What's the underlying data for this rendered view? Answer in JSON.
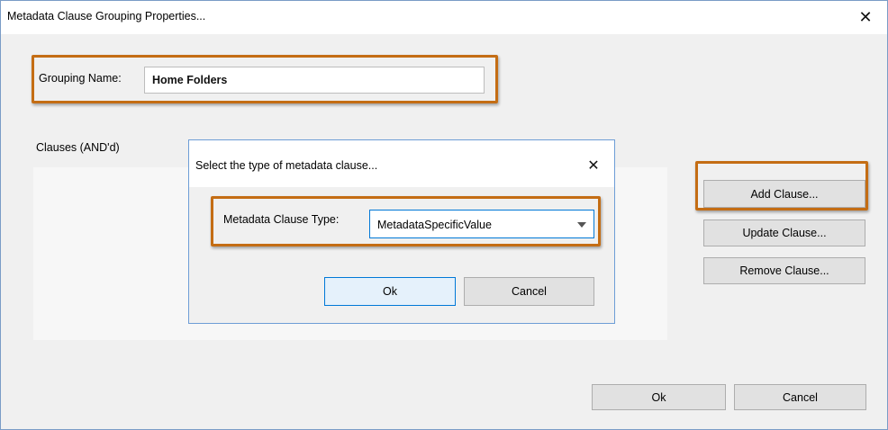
{
  "window": {
    "title": "Metadata Clause Grouping Properties...",
    "close_glyph": "✕"
  },
  "grouping": {
    "label": "Grouping Name:",
    "value": "Home Folders"
  },
  "clauses": {
    "label": "Clauses (AND'd)",
    "items": []
  },
  "side_buttons": {
    "add": "Add Clause...",
    "update": "Update Clause...",
    "remove": "Remove Clause..."
  },
  "footer": {
    "ok": "Ok",
    "cancel": "Cancel"
  },
  "type_dialog": {
    "title": "Select the type of metadata clause...",
    "close_glyph": "✕",
    "type_label": "Metadata Clause Type:",
    "type_value": "MetadataSpecificValue",
    "ok": "Ok",
    "cancel": "Cancel"
  },
  "icons": {
    "close": "close-icon",
    "dropdown": "chevron-down-icon"
  },
  "colors": {
    "highlight": "#c46d14",
    "focus_border": "#0078d7",
    "dialog_bg": "#f0f0f0"
  }
}
